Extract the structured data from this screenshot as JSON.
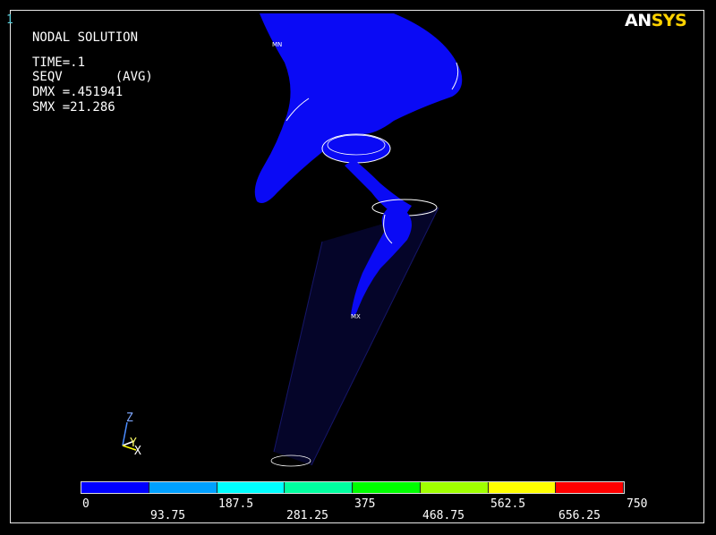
{
  "window_number": "1",
  "info": {
    "line1": "NODAL SOLUTION",
    "line2": "TIME=.1",
    "line3": "SEQV       (AVG)",
    "line4": "DMX =.451941",
    "line5": "SMX =21.286"
  },
  "logo": {
    "part1": "AN",
    "part2": "SYS"
  },
  "markers": {
    "min": "MN",
    "max": "MX"
  },
  "triad": {
    "z": "Z",
    "y": "Y",
    "x": "X"
  },
  "legend": {
    "colors": [
      "#0000ff",
      "#00a0ff",
      "#00ffff",
      "#00ffa0",
      "#00ff00",
      "#a0ff00",
      "#ffff00",
      "#ff0000"
    ],
    "ticks_top": [
      "0",
      "187.5",
      "375",
      "562.5",
      "750"
    ],
    "ticks_bottom": [
      "93.75",
      "281.25",
      "468.75",
      "656.25"
    ]
  },
  "model_color": "#0a0af5"
}
